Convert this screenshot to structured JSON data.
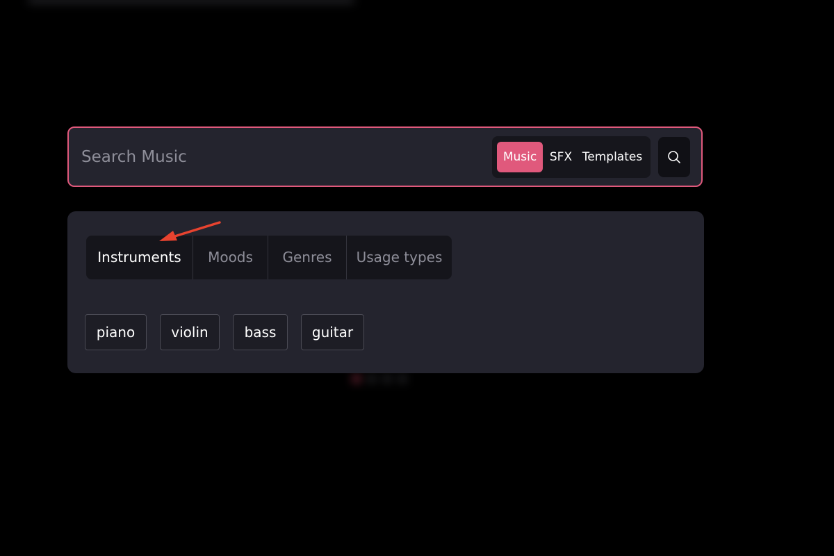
{
  "search": {
    "placeholder": "Search Music",
    "value": ""
  },
  "content_types": [
    {
      "label": "Music",
      "active": true
    },
    {
      "label": "SFX",
      "active": false
    },
    {
      "label": "Templates",
      "active": false
    }
  ],
  "search_button": {
    "icon": "search-icon"
  },
  "category_tabs": [
    {
      "label": "Instruments",
      "active": true
    },
    {
      "label": "Moods",
      "active": false
    },
    {
      "label": "Genres",
      "active": false
    },
    {
      "label": "Usage types",
      "active": false
    }
  ],
  "tags": [
    "piano",
    "violin",
    "bass",
    "guitar"
  ],
  "colors": {
    "accent": "#e0597c",
    "panel": "#24242e",
    "tab_bg": "#15151b",
    "annotation": "#e8432f"
  }
}
